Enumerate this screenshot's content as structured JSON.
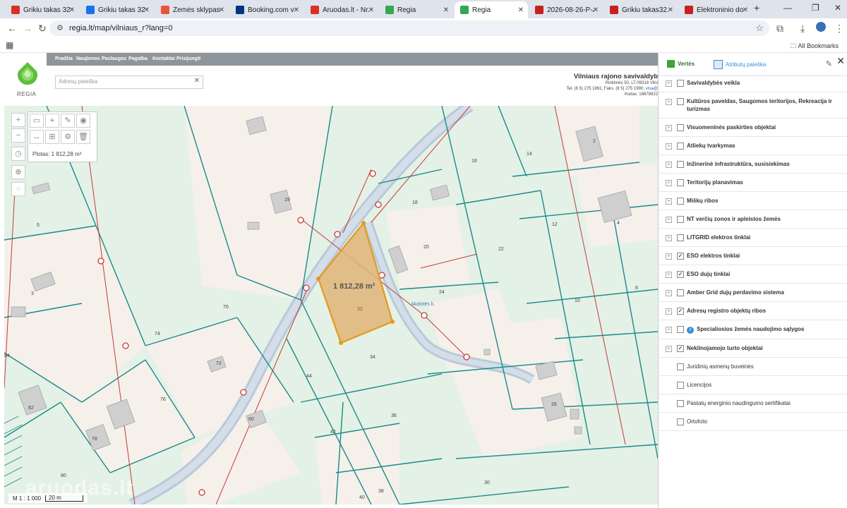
{
  "browser": {
    "tabs": [
      {
        "title": "Grikiu takas 32 sk",
        "color": "#d93025",
        "active": false
      },
      {
        "title": "Grikiu takas 32 sk",
        "color": "#1a73e8",
        "active": false
      },
      {
        "title": "Žemės sklypas Ak",
        "color": "#e8553e",
        "active": false
      },
      {
        "title": "Booking.com vieš",
        "color": "#003580",
        "active": false
      },
      {
        "title": "Aruodas.lt - Nr.1",
        "color": "#d93025",
        "active": false
      },
      {
        "title": "Regia",
        "color": "#34a853",
        "active": false
      },
      {
        "title": "Regia",
        "color": "#34a853",
        "active": true
      },
      {
        "title": "2026-08-26-P-A1",
        "color": "#c5221f",
        "active": false
      },
      {
        "title": "Grikiu takas32.pdf",
        "color": "#c5221f",
        "active": false
      },
      {
        "title": "Elektroninio doku",
        "color": "#c5221f",
        "active": false
      }
    ],
    "new_tab": "+",
    "url": "regia.lt/map/vilniaus_r?lang=0",
    "all_bookmarks": "All Bookmarks"
  },
  "site": {
    "nav": [
      "Pradžia",
      "Naujienos",
      "Paslaugos",
      "Pagalba",
      "Kontaktai",
      "Prisijungti"
    ],
    "logo_text": "REGIA",
    "search_placeholder": "Adresų paieška",
    "municipality": "Vilniaus rajono savivaldyb",
    "address": "Rinktinės 50, LT-09318 Vilni",
    "phone_line": "Tel. (8 5) 275 1961; Faks. (8 5) 275 1990,",
    "email": "vrsa@",
    "code_line": "Kodas: 18878822"
  },
  "map": {
    "area_label": "Plotas: 1 812,28 m²",
    "parcel_area": "1 812,28 m²",
    "street_label": "Akalotės k.",
    "scale": "M 1 : 1 000",
    "scale_bar": "20 m",
    "watermark": "aruodas.lt",
    "parcel_numbers": [
      {
        "n": "19"
      },
      {
        "n": "5"
      },
      {
        "n": "3"
      },
      {
        "n": "70"
      },
      {
        "n": "74"
      },
      {
        "n": "72"
      },
      {
        "n": "76"
      },
      {
        "n": "82"
      },
      {
        "n": "78"
      },
      {
        "n": "80"
      },
      {
        "n": "60"
      },
      {
        "n": "44"
      },
      {
        "n": "42"
      },
      {
        "n": "36"
      },
      {
        "n": "34"
      },
      {
        "n": "38"
      },
      {
        "n": "40"
      },
      {
        "n": "32"
      },
      {
        "n": "18"
      },
      {
        "n": "20"
      },
      {
        "n": "24"
      },
      {
        "n": "22"
      },
      {
        "n": "16"
      },
      {
        "n": "14"
      },
      {
        "n": "12"
      },
      {
        "n": "10"
      },
      {
        "n": "2"
      },
      {
        "n": "4"
      },
      {
        "n": "6"
      },
      {
        "n": "26"
      },
      {
        "n": "30"
      },
      {
        "n": "84"
      }
    ]
  },
  "panel": {
    "tab_layers": "Vertės",
    "tab_search": "Atributų paieška",
    "layers": [
      {
        "label": "Savivaldybės veikla",
        "checked": false,
        "expand": true,
        "bold": true
      },
      {
        "label": "Kultūros paveldas, Saugomos teritorijos, Rekreacija ir turizmas",
        "checked": false,
        "expand": true,
        "bold": true
      },
      {
        "label": "Visuomeninės paskirties objektai",
        "checked": false,
        "expand": true,
        "bold": true
      },
      {
        "label": "Atliekų tvarkymas",
        "checked": false,
        "expand": true,
        "bold": true
      },
      {
        "label": "Inžinerinė infrastruktūra, susisiekimas",
        "checked": false,
        "expand": true,
        "bold": true
      },
      {
        "label": "Teritorijų planavimas",
        "checked": false,
        "expand": true,
        "bold": true
      },
      {
        "label": "Miškų ribos",
        "checked": false,
        "expand": true,
        "bold": true
      },
      {
        "label": "NT verčių zonos ir apleistos žemės",
        "checked": false,
        "expand": true,
        "bold": true
      },
      {
        "label": "LITGRID elektros tinklai",
        "checked": false,
        "expand": true,
        "bold": true
      },
      {
        "label": "ESO elektros tinklai",
        "checked": true,
        "expand": true,
        "bold": true
      },
      {
        "label": "ESO dujų tinklai",
        "checked": true,
        "expand": true,
        "bold": true
      },
      {
        "label": "Amber Grid dujų perdavimo sistema",
        "checked": false,
        "expand": true,
        "bold": true
      },
      {
        "label": "Adresų registro objektų ribos",
        "checked": true,
        "expand": true,
        "bold": true
      },
      {
        "label": "Specialiosios žemės naudojimo sąlygos",
        "checked": false,
        "expand": true,
        "bold": true,
        "info": true
      },
      {
        "label": "Nekilnojamojo turto objektai",
        "checked": true,
        "expand": true,
        "bold": true
      },
      {
        "label": "Juridinių asmenų buveinės",
        "checked": false,
        "expand": false,
        "bold": false
      },
      {
        "label": "Licencijos",
        "checked": false,
        "expand": false,
        "bold": false
      },
      {
        "label": "Pastatų energinio naudingumo sertifikatai",
        "checked": false,
        "expand": false,
        "bold": false
      },
      {
        "label": "Ortofoto",
        "checked": false,
        "expand": false,
        "bold": false
      }
    ]
  }
}
